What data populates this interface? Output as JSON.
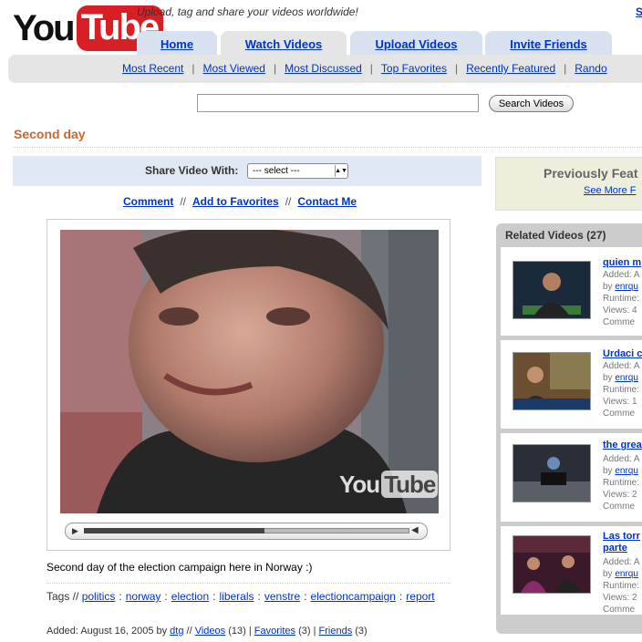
{
  "header": {
    "logo_you": "You",
    "logo_tube": "Tube",
    "tagline": "Upload, tag and share your videos worldwide!",
    "signup": "S"
  },
  "tabs": [
    {
      "label": "Home"
    },
    {
      "label": "Watch Videos"
    },
    {
      "label": "Upload Videos"
    },
    {
      "label": "Invite Friends"
    }
  ],
  "subnav": [
    "Most Recent",
    "Most Viewed",
    "Most Discussed",
    "Top Favorites",
    "Recently Featured",
    "Rando"
  ],
  "search": {
    "button": "Search Videos",
    "value": ""
  },
  "video": {
    "title": "Second day",
    "share_label": "Share Video With:",
    "share_select": "--- select ---",
    "actions": [
      "Comment",
      "Add to Favorites",
      "Contact Me"
    ],
    "watermark_you": "You",
    "watermark_tube": "Tube",
    "progress": 0.55,
    "description": "Second day of the election campaign here in Norway :)",
    "tags_label": "Tags //",
    "tags": [
      "politics",
      "norway",
      "election",
      "liberals",
      "venstre",
      "electioncampaign",
      "report"
    ],
    "added_prefix": "Added: August 16, 2005 by",
    "author": "dtg",
    "sep1": "//",
    "videos_label": "Videos",
    "videos_count": "(13)",
    "favorites_label": "Favorites",
    "favorites_count": "(3)",
    "friends_label": "Friends",
    "friends_count": "(3)"
  },
  "sidebar": {
    "prev_title": "Previously Feat",
    "see_more": "See More F",
    "related_title": "Related Videos (27)",
    "related": [
      {
        "title": "quien m",
        "added": "Added: A",
        "by": "by",
        "user": "enrqu",
        "runtime": "Runtime:",
        "views": "Views: 4",
        "comments": "Comme"
      },
      {
        "title": "Urdaci c",
        "added": "Added: A",
        "by": "by",
        "user": "enrqu",
        "runtime": "Runtime:",
        "views": "Views: 1",
        "comments": "Comme"
      },
      {
        "title": "the grea",
        "added": "Added: A",
        "by": "by",
        "user": "enrqu",
        "runtime": "Runtime:",
        "views": "Views: 2",
        "comments": "Comme"
      },
      {
        "title": "Las torr",
        "title2": "parte",
        "added": "Added: A",
        "by": "by",
        "user": "enrqu",
        "runtime": "Runtime:",
        "views": "Views: 2",
        "comments": "Comme"
      }
    ]
  }
}
